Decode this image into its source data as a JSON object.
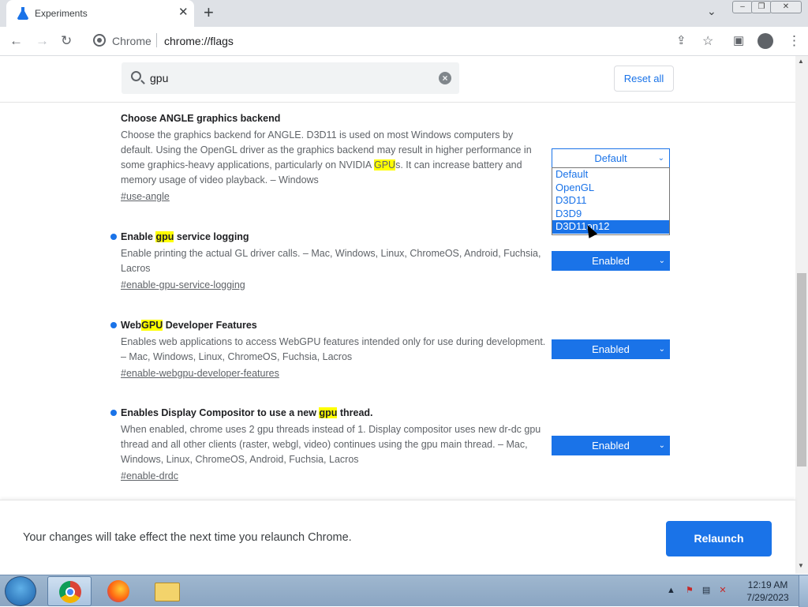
{
  "browser": {
    "tab_title": "Experiments",
    "tab_close": "✕",
    "new_tab": "+",
    "tab_search": "⌄",
    "window_controls": [
      "–",
      "❐",
      "✕"
    ],
    "omnibox": {
      "site": "Chrome",
      "url": "chrome://flags"
    }
  },
  "flags": {
    "search_value": "gpu",
    "reset_label": "Reset all",
    "experiments": [
      {
        "name": "Choose ANGLE graphics backend",
        "desc_before": "Choose the graphics backend for ANGLE. D3D11 is used on most Windows computers by default. Using the OpenGL driver as the graphics backend may result in higher performance in some graphics-heavy applications, particularly on NVIDIA ",
        "desc_hl": "GPU",
        "desc_after": "s. It can increase battery and memory usage of video playback. – Windows",
        "link": "#use-angle",
        "value": "Default",
        "options": [
          "Default",
          "OpenGL",
          "D3D11",
          "D3D9",
          "D3D11on12"
        ],
        "highlighted_option": "D3D11on12"
      },
      {
        "name_before": "Enable ",
        "name_hl": "gpu",
        "name_after": " service logging",
        "desc": "Enable printing the actual GL driver calls. – Mac, Windows, Linux, ChromeOS, Android, Fuchsia, Lacros",
        "link": "#enable-gpu-service-logging",
        "value": "Enabled"
      },
      {
        "name_before": "Web",
        "name_hl": "GPU",
        "name_after": " Developer Features",
        "desc": "Enables web applications to access WebGPU features intended only for use during development. – Mac, Windows, Linux, ChromeOS, Fuchsia, Lacros",
        "link": "#enable-webgpu-developer-features",
        "value": "Enabled"
      },
      {
        "name_before": "Enables Display Compositor to use a new ",
        "name_hl": "gpu",
        "name_after": " thread.",
        "desc": "When enabled, chrome uses 2 gpu threads instead of 1. Display compositor uses new dr-dc gpu thread and all other clients (raster, webgl, video) continues using the gpu main thread. – Mac, Windows, Linux, ChromeOS, Android, Fuchsia, Lacros",
        "link": "#enable-drdc",
        "value": "Enabled"
      }
    ],
    "relaunch_message": "Your changes will take effect the next time you relaunch Chrome.",
    "relaunch_label": "Relaunch"
  },
  "taskbar": {
    "time": "12:19 AM",
    "date": "7/29/2023",
    "apps": [
      "chrome-icon",
      "firefox-icon",
      "file-explorer-icon"
    ]
  },
  "colors": {
    "accent": "#1a73e8",
    "highlight": "#ffff00"
  }
}
